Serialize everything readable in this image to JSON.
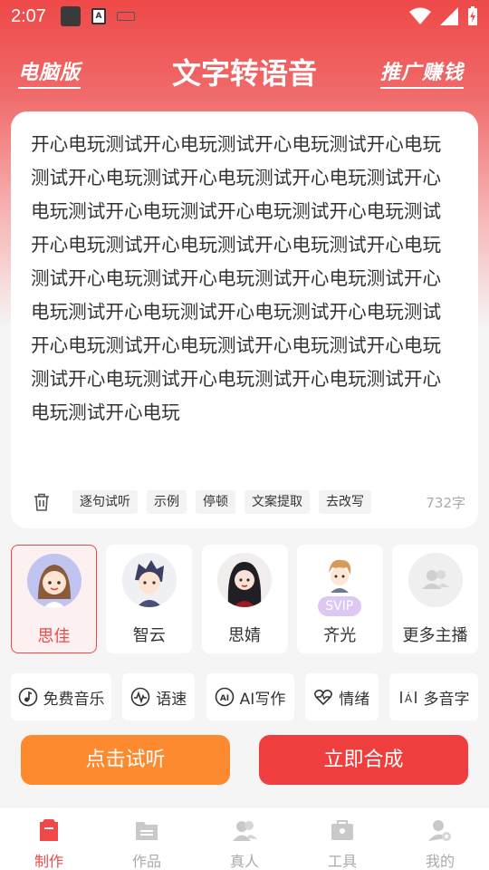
{
  "status": {
    "time": "2:07"
  },
  "header": {
    "left_label": "电脑版",
    "title": "文字转语音",
    "right_label": "推广赚钱"
  },
  "editor": {
    "text": "开心电玩测试开心电玩测试开心电玩测试开心电玩测试开心电玩测试开心电玩测试开心电玩测试开心电玩测试开心电玩测试开心电玩测试开心电玩测试开心电玩测试开心电玩测试开心电玩测试开心电玩测试开心电玩测试开心电玩测试开心电玩测试开心电玩测试开心电玩测试开心电玩测试开心电玩测试开心电玩测试开心电玩测试开心电玩测试开心电玩测试开心电玩测试开心电玩测试开心电玩测试开心电玩测试开心电玩",
    "tools": [
      "逐句试听",
      "示例",
      "停顿",
      "文案提取",
      "去改写"
    ],
    "char_count": "732字"
  },
  "voices": [
    {
      "name": "思佳",
      "selected": true
    },
    {
      "name": "智云",
      "selected": false
    },
    {
      "name": "思婧",
      "selected": false
    },
    {
      "name": "齐光",
      "selected": false,
      "badge": "SVIP"
    },
    {
      "name": "更多主播",
      "selected": false
    }
  ],
  "features": [
    {
      "label": "免费音乐",
      "icon": "music-note-icon"
    },
    {
      "label": "语速",
      "icon": "speed-wave-icon"
    },
    {
      "label": "AI写作",
      "icon": "ai-icon"
    },
    {
      "label": "情绪",
      "icon": "heart-pulse-icon"
    },
    {
      "label": "多音字",
      "icon": "pinyin-icon"
    }
  ],
  "actions": {
    "listen": "点击试听",
    "synthesize": "立即合成"
  },
  "nav": [
    {
      "label": "制作",
      "active": true
    },
    {
      "label": "作品",
      "active": false
    },
    {
      "label": "真人",
      "active": false
    },
    {
      "label": "工具",
      "active": false
    },
    {
      "label": "我的",
      "active": false
    }
  ],
  "colors": {
    "primary": "#ef4848",
    "orange": "#fd8a2e",
    "inactive": "#aaaaaa"
  }
}
